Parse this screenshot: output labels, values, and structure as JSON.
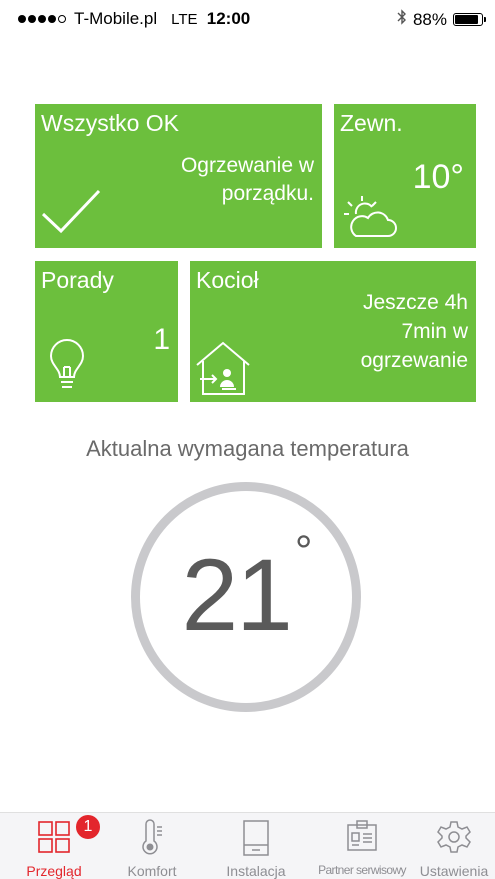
{
  "status_bar": {
    "carrier": "T-Mobile.pl",
    "network": "LTE",
    "time": "12:00",
    "battery": "88%",
    "battery_level": 0.88
  },
  "tiles": {
    "status": {
      "title": "Wszystko OK",
      "message": "Ogrzewanie w porządku."
    },
    "outside": {
      "title": "Zewn.",
      "temperature": "10°"
    },
    "tips": {
      "title": "Porady",
      "count": "1"
    },
    "boiler": {
      "title": "Kocioł",
      "message_line1": "Jeszcze 4h",
      "message_line2": "7min w",
      "message_line3": "ogrzewanie"
    }
  },
  "required_temp": {
    "label": "Aktualna wymagana temperatura",
    "value": "21",
    "unit": "°"
  },
  "tab_bar": {
    "active_color": "#e3262c",
    "items": [
      {
        "label": "Przegląd",
        "badge": "1",
        "icon": "grid-icon"
      },
      {
        "label": "Komfort",
        "icon": "thermometer-icon"
      },
      {
        "label": "Instalacja",
        "icon": "device-icon"
      },
      {
        "label": "Partner serwisowy",
        "icon": "id-card-icon"
      },
      {
        "label": "Ustawienia",
        "icon": "gear-icon"
      }
    ]
  },
  "colors": {
    "tile_green": "#6cbf3d",
    "gauge_ring": "#c9c9cc"
  }
}
